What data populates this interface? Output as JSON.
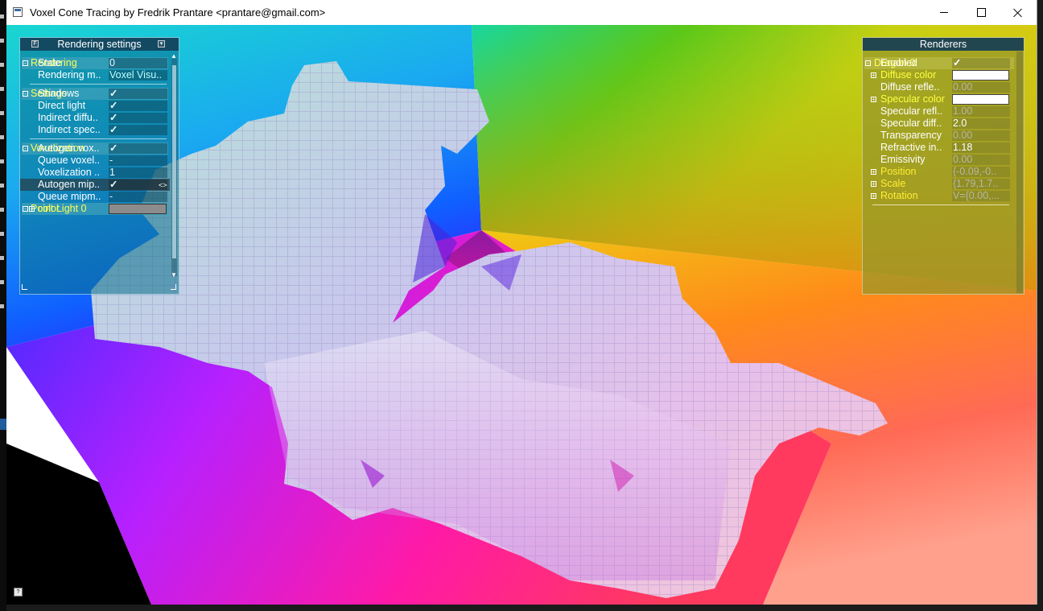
{
  "window": {
    "title": "Voxel Cone Tracing by Fredrik Prantare <prantare@gmail.com>",
    "controls": [
      "minimize",
      "maximize",
      "close"
    ]
  },
  "rendering_settings": {
    "title": "Rendering settings",
    "header_buttons": [
      "F",
      "▾"
    ],
    "groups": [
      {
        "name": "Rendering",
        "rows": [
          {
            "label": "State",
            "value": "0"
          },
          {
            "label": "Rendering m..",
            "value": "Voxel Visu.."
          }
        ]
      },
      {
        "name": "Settings",
        "rows": [
          {
            "label": "Shadows",
            "value": "✓"
          },
          {
            "label": "Direct light",
            "value": "✓"
          },
          {
            "label": "Indirect diffu..",
            "value": "✓"
          },
          {
            "label": "Indirect spec..",
            "value": "✓"
          }
        ]
      },
      {
        "name": "Voxelization",
        "rows": [
          {
            "label": "Autogen vox..",
            "value": "✓"
          },
          {
            "label": "Queue voxel..",
            "value": "-"
          },
          {
            "label": "Voxelization ..",
            "value": "1"
          },
          {
            "label": "Autogen mip..",
            "value": "✓"
          },
          {
            "label": "Queue mipm..",
            "value": "-"
          }
        ]
      },
      {
        "name": "Point Light 0",
        "rows": [
          {
            "label": "color",
            "value": ""
          }
        ]
      }
    ],
    "selected_row_icon": "<>",
    "point_light_color": "#8c8c8c"
  },
  "renderers": {
    "title": "Renderers",
    "group": "Dragon 0",
    "rows": [
      {
        "label": "Enabled",
        "value": "✓"
      },
      {
        "label": "Diffuse color",
        "value": ""
      },
      {
        "label": "Diffuse refle..",
        "value": "0.00"
      },
      {
        "label": "Specular color",
        "value": ""
      },
      {
        "label": "Specular refl..",
        "value": "1.00"
      },
      {
        "label": "Specular diff..",
        "value": "2.0"
      },
      {
        "label": "Transparency",
        "value": "0.00"
      },
      {
        "label": "Refractive in..",
        "value": "1.18"
      },
      {
        "label": "Emissivity",
        "value": "0.00"
      },
      {
        "label": "Position",
        "value": "{-0.09,-0.."
      },
      {
        "label": "Scale",
        "value": "{1.79,1.7.."
      },
      {
        "label": "Rotation",
        "value": "V={0.00,..."
      }
    ]
  },
  "colors": {
    "rendering_bar": "#0a6e8c",
    "renderers_bar": "#969628",
    "group_label": "#ffff55",
    "checkmark": "#9dff5f"
  },
  "help_icon": "?"
}
